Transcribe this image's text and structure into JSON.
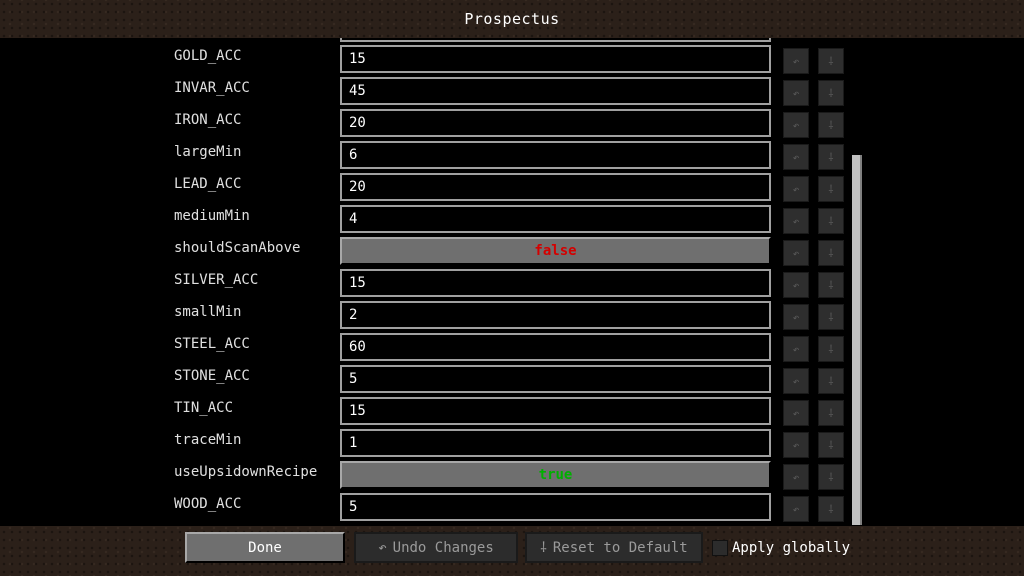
{
  "title": "Prospectus",
  "entries": [
    {
      "label": "GOLD_ACC",
      "value": "15",
      "type": "text"
    },
    {
      "label": "INVAR_ACC",
      "value": "45",
      "type": "text"
    },
    {
      "label": "IRON_ACC",
      "value": "20",
      "type": "text"
    },
    {
      "label": "largeMin",
      "value": "6",
      "type": "text"
    },
    {
      "label": "LEAD_ACC",
      "value": "20",
      "type": "text"
    },
    {
      "label": "mediumMin",
      "value": "4",
      "type": "text"
    },
    {
      "label": "shouldScanAbove",
      "value": "false",
      "type": "toggle",
      "color": "#d40000"
    },
    {
      "label": "SILVER_ACC",
      "value": "15",
      "type": "text"
    },
    {
      "label": "smallMin",
      "value": "2",
      "type": "text"
    },
    {
      "label": "STEEL_ACC",
      "value": "60",
      "type": "text"
    },
    {
      "label": "STONE_ACC",
      "value": "5",
      "type": "text"
    },
    {
      "label": "TIN_ACC",
      "value": "15",
      "type": "text"
    },
    {
      "label": "traceMin",
      "value": "1",
      "type": "text"
    },
    {
      "label": "useUpsidownRecipe",
      "value": "true",
      "type": "toggle",
      "color": "#00b000"
    },
    {
      "label": "WOOD_ACC",
      "value": "5",
      "type": "text"
    }
  ],
  "row_icons": {
    "undo": "undo-icon",
    "reset": "reset-icon"
  },
  "footer": {
    "done_label": "Done",
    "undo_label": "Undo Changes",
    "reset_label": "Reset to Default",
    "apply_label": "Apply globally",
    "undo_icon": "↶",
    "reset_icon": "⸸"
  }
}
